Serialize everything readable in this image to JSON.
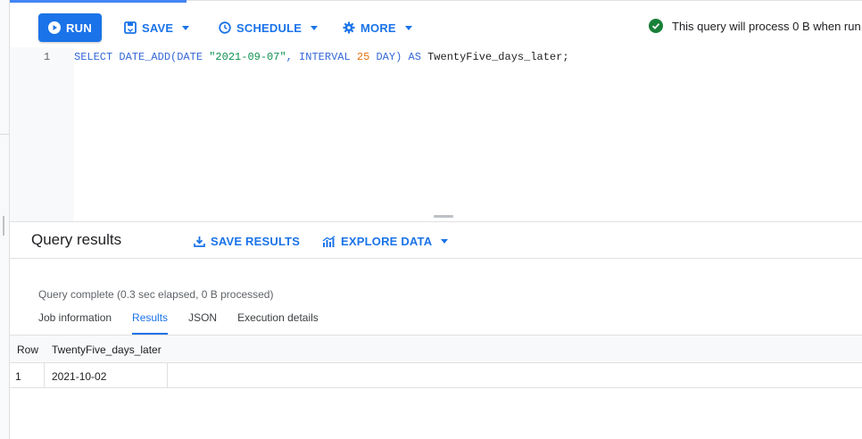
{
  "toolbar": {
    "run_label": "RUN",
    "save_label": "SAVE",
    "schedule_label": "SCHEDULE",
    "more_label": "MORE",
    "status_text": "This query will process 0 B when run."
  },
  "editor": {
    "line_number": "1",
    "code_tokens": {
      "t1": "SELECT DATE_ADD(DATE ",
      "t2": "\"2021-09-07\"",
      "t3": ", INTERVAL ",
      "t4": "25",
      "t5": " DAY) AS ",
      "t6": "TwentyFive_days_later;"
    }
  },
  "results": {
    "title": "Query results",
    "save_results_label": "SAVE RESULTS",
    "explore_data_label": "EXPLORE DATA",
    "status": "Query complete (0.3 sec elapsed, 0 B processed)",
    "tabs": [
      {
        "label": "Job information"
      },
      {
        "label": "Results"
      },
      {
        "label": "JSON"
      },
      {
        "label": "Execution details"
      }
    ],
    "active_tab": "Results",
    "table": {
      "headers": [
        "Row",
        "TwentyFive_days_later"
      ],
      "rows": [
        {
          "row": "1",
          "value": "2021-10-02"
        }
      ]
    }
  },
  "colors": {
    "accent": "#1a73e8",
    "success": "#188038",
    "string": "#0d904f",
    "number": "#e8710a"
  },
  "icons": [
    "play-icon",
    "save-icon",
    "clock-icon",
    "gear-icon",
    "check-circle-icon",
    "download-icon",
    "chart-icon",
    "chevron-down-icon"
  ]
}
